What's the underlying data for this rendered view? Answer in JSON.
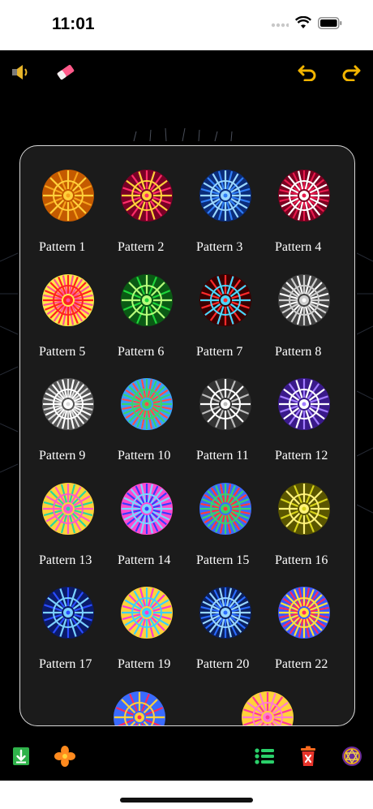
{
  "status": {
    "time": "11:01"
  },
  "toolbar": {
    "left": [
      {
        "name": "sound-icon"
      },
      {
        "name": "eraser-icon"
      }
    ],
    "right": [
      {
        "name": "undo-icon"
      },
      {
        "name": "redo-icon"
      }
    ]
  },
  "patterns": {
    "items": [
      {
        "label": "Pattern 1",
        "colors": [
          "#f6a21b",
          "#ffcf3a",
          "#c45a00"
        ]
      },
      {
        "label": "Pattern 2",
        "colors": [
          "#ff2d6a",
          "#ffd23a",
          "#7a0026"
        ]
      },
      {
        "label": "Pattern 3",
        "colors": [
          "#2f7df6",
          "#9ad7ff",
          "#0a2c7a"
        ]
      },
      {
        "label": "Pattern 4",
        "colors": [
          "#e8194c",
          "#ffffff",
          "#7a0020"
        ]
      },
      {
        "label": "Pattern 5",
        "colors": [
          "#ff4f9a",
          "#ff2222",
          "#ffe84a"
        ]
      },
      {
        "label": "Pattern 6",
        "colors": [
          "#1fd43b",
          "#b7ff7a",
          "#0a5a14"
        ]
      },
      {
        "label": "Pattern 7",
        "colors": [
          "#ff2a2a",
          "#4ad7ff",
          "#3a0000"
        ]
      },
      {
        "label": "Pattern 8",
        "colors": [
          "#ffffff",
          "#cfcfcf",
          "#444444"
        ]
      },
      {
        "label": "Pattern 9",
        "colors": [
          "#dddddd",
          "#ffffff",
          "#555555"
        ]
      },
      {
        "label": "Pattern 10",
        "colors": [
          "#ff4d4d",
          "#3ad36b",
          "#3aa0ff"
        ]
      },
      {
        "label": "Pattern 11",
        "colors": [
          "#bdbdbd",
          "#ffffff",
          "#333333"
        ]
      },
      {
        "label": "Pattern 12",
        "colors": [
          "#a17bff",
          "#ffffff",
          "#3a1a8a"
        ]
      },
      {
        "label": "Pattern 13",
        "colors": [
          "#2bd6a0",
          "#ff5ac8",
          "#ffd23a"
        ]
      },
      {
        "label": "Pattern 14",
        "colors": [
          "#3a3cff",
          "#7ad7ff",
          "#ff4ad0"
        ]
      },
      {
        "label": "Pattern 15",
        "colors": [
          "#ff3a3a",
          "#3ad16b",
          "#3a6bff"
        ]
      },
      {
        "label": "Pattern 16",
        "colors": [
          "#d6d21a",
          "#fff27a",
          "#5a5600"
        ]
      },
      {
        "label": "Pattern 17",
        "colors": [
          "#2a4cff",
          "#7ad0ff",
          "#0a1a6a"
        ]
      },
      {
        "label": "Pattern 19",
        "colors": [
          "#ff3ad0",
          "#3ad0ff",
          "#ffd23a"
        ]
      },
      {
        "label": "Pattern 20",
        "colors": [
          "#2a6bff",
          "#9ad7ff",
          "#0a2060"
        ]
      },
      {
        "label": "Pattern 22",
        "colors": [
          "#ff2a5a",
          "#ffe23a",
          "#3a5aff"
        ]
      },
      {
        "label": "",
        "colors": [
          "#ff2a5a",
          "#ffd23a",
          "#3a6bff"
        ]
      },
      {
        "label": "",
        "colors": [
          "#ff3a9a",
          "#ff7ad0",
          "#ffd23a"
        ]
      }
    ]
  },
  "bottom_toolbar": {
    "left": [
      {
        "name": "download-icon"
      },
      {
        "name": "flower-icon"
      }
    ],
    "right": [
      {
        "name": "list-icon"
      },
      {
        "name": "delete-icon"
      },
      {
        "name": "badge-icon"
      }
    ]
  }
}
